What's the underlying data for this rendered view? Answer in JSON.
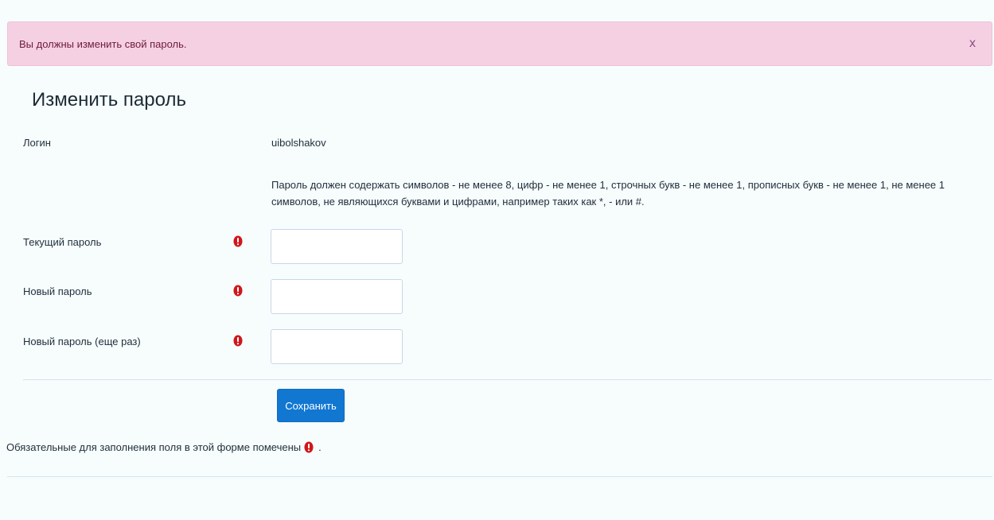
{
  "alert": {
    "message": "Вы должны изменить свой пароль.",
    "close_label": "x"
  },
  "page": {
    "title": "Изменить пароль"
  },
  "form": {
    "login_label": "Логин",
    "login_value": "uibolshakov",
    "password_hint": "Пароль должен содержать символов - не менее 8, цифр - не менее 1, строчных букв - не менее 1, прописных букв - не менее 1, не менее 1 символов, не являющихся буквами и цифрами, например таких как *, - или #.",
    "fields": [
      {
        "label": "Текущий пароль",
        "value": ""
      },
      {
        "label": "Новый пароль",
        "value": ""
      },
      {
        "label": "Новый пароль (еще раз)",
        "value": ""
      }
    ],
    "required_icon": "exclamation-circle-icon",
    "save_label": "Сохранить"
  },
  "footer": {
    "required_note": "Обязательные для заполнения поля в этой форме помечены",
    "required_note_suffix": "."
  },
  "colors": {
    "alert_background": "#f5d0e3",
    "accent": "#1177d1",
    "required": "#d0161b"
  }
}
